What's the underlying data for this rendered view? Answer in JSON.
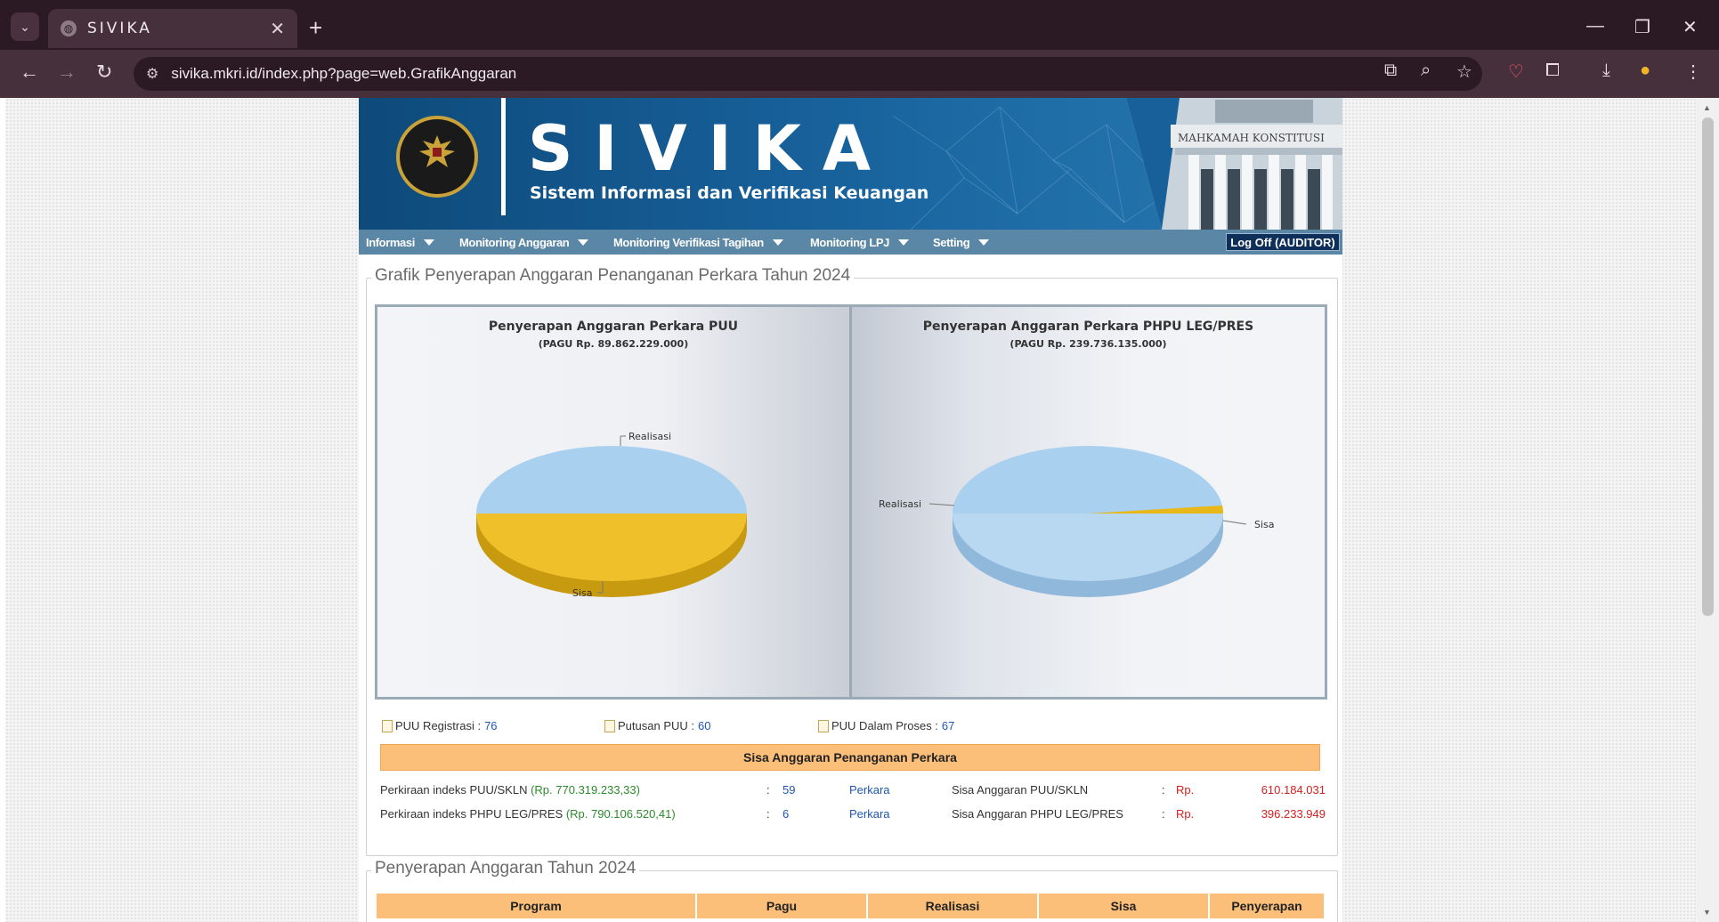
{
  "browser": {
    "tab_title": "SIVIKA",
    "url": "sivika.mkri.id/index.php?page=web.GrafikAnggaran"
  },
  "header": {
    "brand": "SIVIKA",
    "subtitle": "Sistem Informasi dan Verifikasi Keuangan",
    "building_sign": "MAHKAMAH KONSTITUSI"
  },
  "menu": {
    "items": [
      "Informasi",
      "Monitoring Anggaran",
      "Monitoring Verifikasi Tagihan",
      "Monitoring LPJ",
      "Setting"
    ],
    "logoff": "Log Off (AUDITOR)"
  },
  "section1": {
    "legend": "Grafik Penyerapan Anggaran Penanganan Perkara Tahun 2024"
  },
  "chart_data": [
    {
      "type": "pie",
      "title": "Penyerapan Anggaran Perkara PUU",
      "subtitle": "(PAGU Rp. 89.862.229.000)",
      "categories": [
        "Realisasi",
        "Sisa"
      ],
      "values": [
        50,
        50
      ],
      "colors": [
        "#a9d0ef",
        "#e8b818"
      ]
    },
    {
      "type": "pie",
      "title": "Penyerapan Anggaran Perkara PHPU LEG/PRES",
      "subtitle": "(PAGU Rp. 239.736.135.000)",
      "categories": [
        "Realisasi",
        "Sisa"
      ],
      "values": [
        98,
        2
      ],
      "colors": [
        "#a9d0ef",
        "#e8b818"
      ]
    }
  ],
  "stats": {
    "registrasi_label": "PUU Registrasi :",
    "registrasi_value": "76",
    "putusan_label": "Putusan PUU :",
    "putusan_value": "60",
    "proses_label": "PUU Dalam Proses :",
    "proses_value": "67"
  },
  "sisa": {
    "header": "Sisa Anggaran Penanganan Perkara",
    "rows": [
      {
        "label": "Perkiraan indeks PUU/SKLN",
        "indeks": "(Rp. 770.319.233,33)",
        "colon": ":",
        "count": "59",
        "unit": "Perkara",
        "sisa_label": "Sisa Anggaran PUU/SKLN",
        "sisa_colon": ":",
        "currency": "Rp.",
        "amount": "610.184.031"
      },
      {
        "label": "Perkiraan indeks PHPU LEG/PRES",
        "indeks": "(Rp. 790.106.520,41)",
        "colon": ":",
        "count": "6",
        "unit": "Perkara",
        "sisa_label": "Sisa Anggaran PHPU LEG/PRES",
        "sisa_colon": ":",
        "currency": "Rp.",
        "amount": "396.233.949"
      }
    ]
  },
  "section2": {
    "legend": "Penyerapan Anggaran Tahun 2024",
    "columns": [
      "Program",
      "Pagu",
      "Realisasi",
      "Sisa",
      "Penyerapan"
    ]
  },
  "colors": {
    "banner_blue": "#17609a",
    "menubar": "#5b87a6",
    "orange_header": "#fbbf7a",
    "pie_blue": "#a9d0ef",
    "pie_gold": "#e8b818"
  }
}
